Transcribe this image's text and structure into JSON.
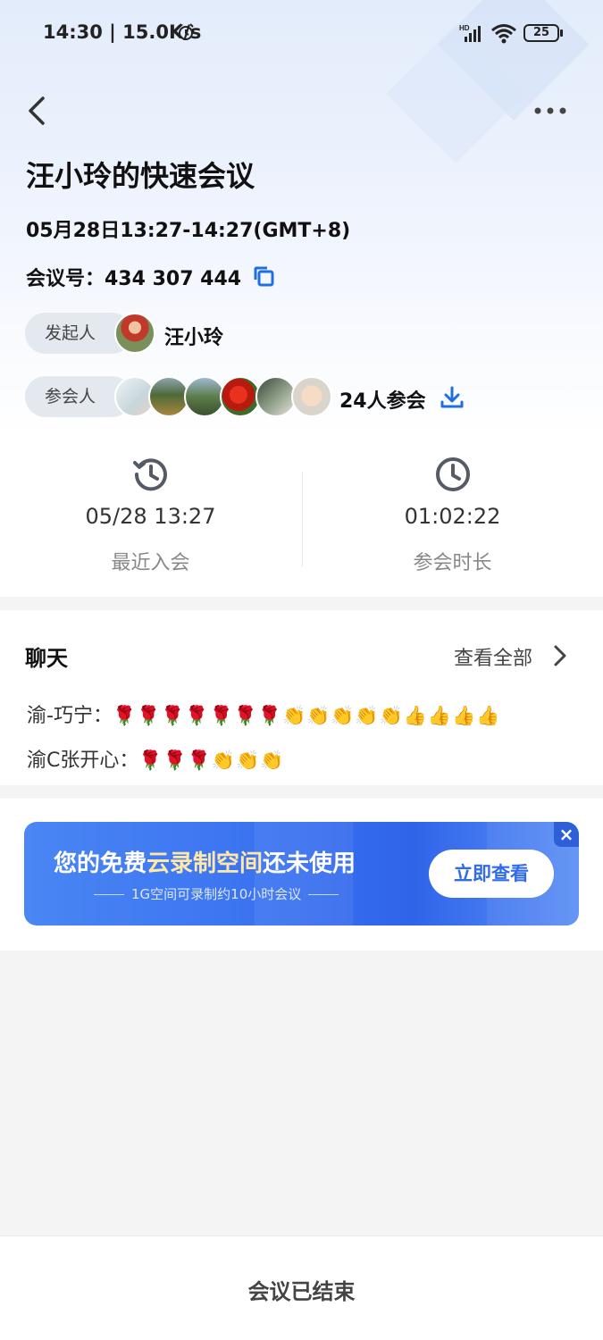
{
  "status_bar": {
    "time": "14:30 | 15.0K/s",
    "battery": "25",
    "icons": [
      "alarm-icon",
      "hd-signal-icon",
      "wifi-icon",
      "battery-icon"
    ]
  },
  "nav": {
    "back_icon": "chevron-left-icon",
    "more_icon": "more-dots-icon"
  },
  "meeting": {
    "title": "汪小玲的快速会议",
    "datetime": "05月28日13:27-14:27(GMT+8)",
    "meeting_id_label": "会议号：434 307 444",
    "host_label": "发起人",
    "host_name": "汪小玲",
    "attendee_label": "参会人",
    "attendee_count": "24人参会"
  },
  "stats": {
    "last_join_value": "05/28 13:27",
    "last_join_label": "最近入会",
    "duration_value": "01:02:22",
    "duration_label": "参会时长"
  },
  "chat": {
    "title": "聊天",
    "view_all": "查看全部",
    "messages": [
      {
        "sender": "渝-巧宁：",
        "content": "🌹🌹🌹🌹🌹🌹🌹👏👏👏👏👏👍👍👍👍"
      },
      {
        "sender": "渝C张开心：",
        "content": "🌹🌹🌹👏👏👏"
      }
    ]
  },
  "banner": {
    "headline_a": "您的免费",
    "headline_b": "云录制空间",
    "headline_c": "还未使用",
    "subtitle": "1G空间可录制约10小时会议",
    "button": "立即查看",
    "close": "×"
  },
  "footer": {
    "status": "会议已结束"
  },
  "colors": {
    "accent": "#1f6fe0",
    "banner": "#3a72f0"
  }
}
